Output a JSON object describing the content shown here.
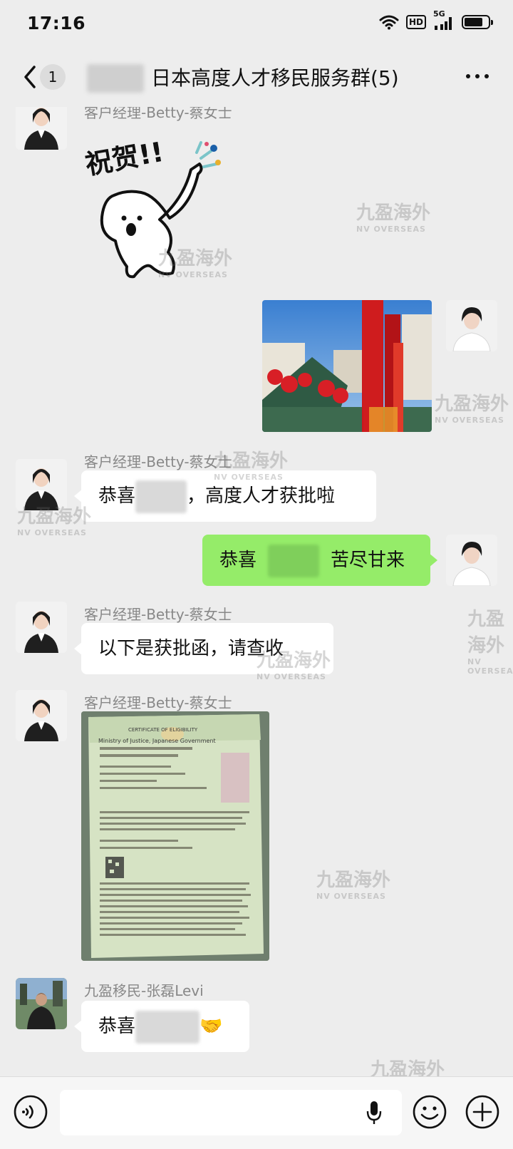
{
  "status_bar": {
    "time": "17:16",
    "hd_label": "HD",
    "network_label": "5G"
  },
  "nav": {
    "unread_count": "1",
    "title": "日本高度人才移民服务群(5)"
  },
  "messages": [
    {
      "side": "left",
      "sender": "客户经理-Betty-蔡女士",
      "type": "sticker",
      "sticker_text": "祝贺!!"
    },
    {
      "side": "right",
      "type": "image",
      "description": "photo-red-pillar"
    },
    {
      "side": "left",
      "sender": "客户经理-Betty-蔡女士",
      "type": "text",
      "text_before": "恭喜",
      "text_after": "，高度人才获批啦"
    },
    {
      "side": "right",
      "type": "text",
      "text_before": "恭喜",
      "text_after": "苦尽甘来"
    },
    {
      "side": "left",
      "sender": "客户经理-Betty-蔡女士",
      "type": "text",
      "text": "以下是获批函，请查收"
    },
    {
      "side": "left",
      "sender": "客户经理-Betty-蔡女士",
      "type": "image",
      "description": "certificate-of-eligibility"
    },
    {
      "side": "left",
      "sender": "九盈移民-张磊Levi",
      "type": "text",
      "text_before": "恭喜",
      "emoji": "🤝"
    }
  ],
  "certificate_text": {
    "header": "CERTIFICATE OF ELIGIBILITY",
    "ministry": "Ministry of Justice, Japanese Government"
  },
  "watermark": {
    "brand_cn": "九盈海外",
    "brand_en": "NV OVERSEAS"
  },
  "colors": {
    "background": "#ededed",
    "bubble_self": "#95ec69",
    "bubble_other": "#ffffff"
  }
}
